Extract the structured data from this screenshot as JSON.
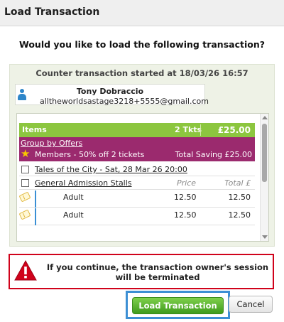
{
  "dialog": {
    "title": "Load Transaction",
    "question": "Would you like to load the following transaction?"
  },
  "transaction": {
    "started_text": "Counter transaction started at 18/03/26 16:57",
    "owner_name": "Tony Dobraccio",
    "owner_email": "alltheworldsastage3218+5555@gmail.com"
  },
  "basket": {
    "items_label": "Items",
    "tickets_count": "2 Tkts",
    "total": "£25.00",
    "group_link": "Group by Offers",
    "offer_name": "Members - 50% off 2 tickets",
    "offer_saving": "Total Saving £25.00",
    "event_label": "Tales of the City - Sat, 28 Mar 26 20:00",
    "area_label": "General Admission Stalls",
    "col_price": "Price",
    "col_total": "Total £",
    "tickets": [
      {
        "type": "Adult",
        "price": "12.50",
        "total": "12.50"
      },
      {
        "type": "Adult",
        "price": "12.50",
        "total": "12.50"
      }
    ]
  },
  "warning": {
    "message": "If you continue, the transaction owner's session will be terminated"
  },
  "buttons": {
    "load": "Load Transaction",
    "cancel": "Cancel"
  },
  "colors": {
    "items_bar": "#8cc63f",
    "offer_bar": "#9b2a6e",
    "warning_border": "#d0021b",
    "load_button": "#4fae28",
    "focus_outline": "#3d8fd4"
  }
}
